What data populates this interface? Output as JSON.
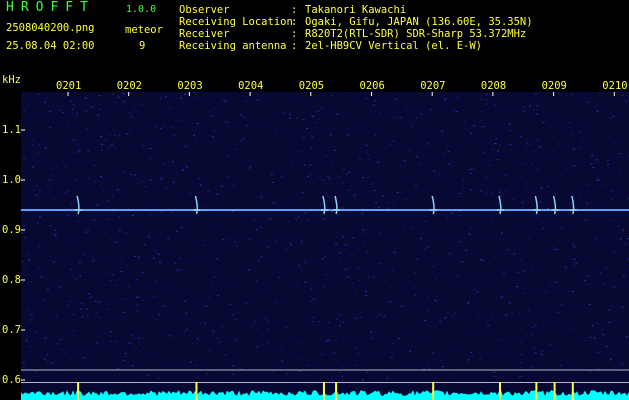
{
  "header": {
    "app_title": "HROFFT",
    "app_version": "1.0.0",
    "file_name": "2508040200.png",
    "datetime": "25.08.04 02:00",
    "meteor_label": "meteor",
    "meteor_count": "9"
  },
  "info": [
    {
      "label": "Observer",
      "value": "Takanori Kawachi"
    },
    {
      "label": "Receiving Location",
      "value": "Ogaki, Gifu, JAPAN (136.60E, 35.35N)"
    },
    {
      "label": "Receiver",
      "value": "R820T2(RTL-SDR) SDR-Sharp 53.372MHz"
    },
    {
      "label": "Receiving antenna",
      "value": "2el-HB9CV Vertical (el. E-W)"
    }
  ],
  "colors": {
    "text_yellow": "#ffff3c",
    "text_green": "#3cff3c",
    "background": "#000000",
    "spectrogram_bg": "#070933",
    "signal_line": "#5aa0ff",
    "noise_cyan": "#00ffff"
  },
  "chart_data": {
    "type": "heatmap",
    "ylabel": "kHz",
    "x_ticks": [
      "0201",
      "0202",
      "0203",
      "0204",
      "0205",
      "0206",
      "0207",
      "0208",
      "0209",
      "0210"
    ],
    "y_ticks": [
      "1.1",
      "1.0",
      "0.9",
      "0.8",
      "0.7",
      "0.6"
    ],
    "ylim": [
      0.58,
      1.17
    ],
    "carrier_khz": 0.94,
    "meteor_echoes_minute": [
      1.15,
      3.1,
      5.2,
      5.4,
      7.0,
      8.1,
      8.7,
      9.0,
      9.3
    ],
    "grid": false
  }
}
